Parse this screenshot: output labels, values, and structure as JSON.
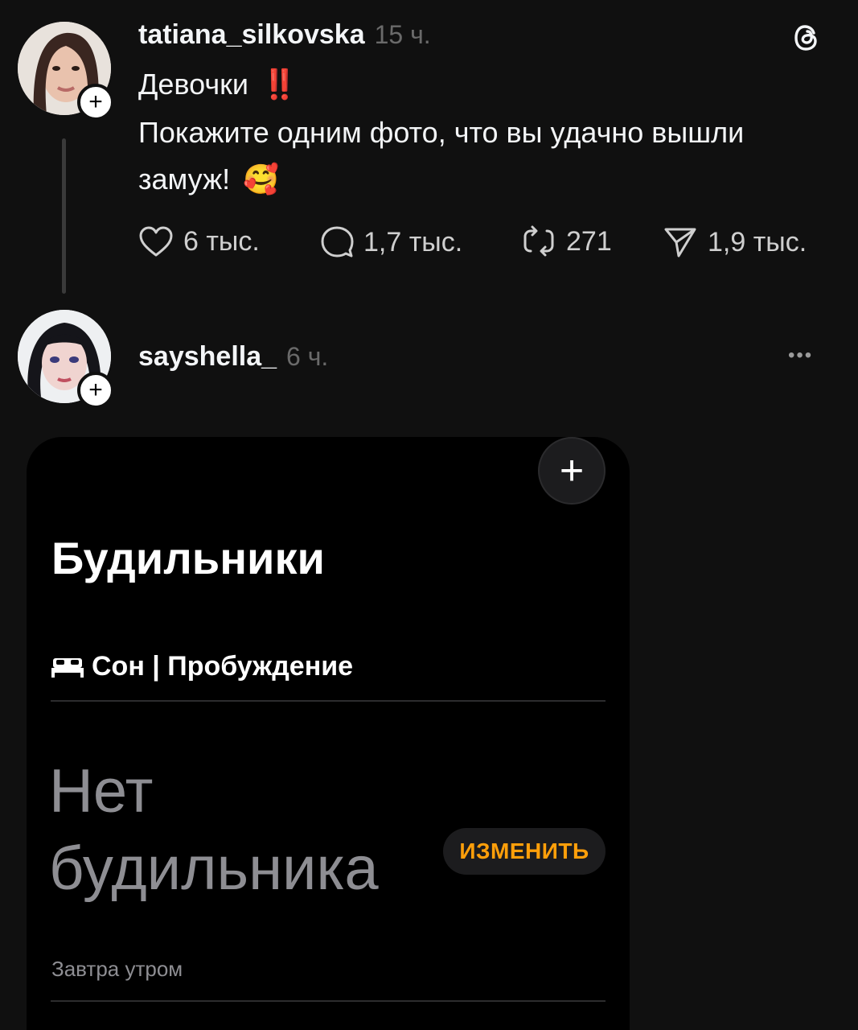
{
  "post1": {
    "username": "tatiana_silkovska",
    "time": "15 ч.",
    "line1": "Девочки",
    "line1_emoji": "‼️",
    "line2": "Покажите одним фото, что вы удачно вышли",
    "line3": "замуж!",
    "line3_emoji": "🥰",
    "likes": "6 тыс.",
    "comments": "1,7 тыс.",
    "reposts": "271",
    "shares": "1,9 тыс."
  },
  "post2": {
    "username": "sayshella_",
    "time": "6 ч.",
    "more": "•••"
  },
  "embedded": {
    "add_symbol": "+",
    "title": "Будильники",
    "section_icon": "bed-icon",
    "section_label": "Сон | Пробуждение",
    "no_alarm_line1": "Нет",
    "no_alarm_line2": "будильника",
    "change_button": "ИЗМЕНИТЬ",
    "subtitle": "Завтра утром"
  },
  "colors": {
    "background": "#101010",
    "accent_orange": "#ff9f0a",
    "alert_red": "#e0342b"
  }
}
